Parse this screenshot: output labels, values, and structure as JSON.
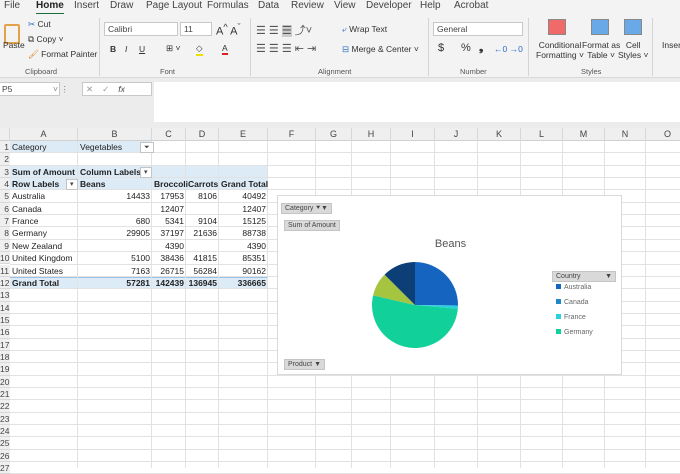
{
  "tabs": [
    "File",
    "Home",
    "Insert",
    "Draw",
    "Page Layout",
    "Formulas",
    "Data",
    "Review",
    "View",
    "Developer",
    "Help",
    "Acrobat"
  ],
  "ribbon": {
    "paste": "Paste",
    "cut": "Cut",
    "copy": "Copy",
    "format_painter": "Format Painter",
    "clipboard": "Clipboard",
    "font_name": "Calibri",
    "font_size": "11",
    "bold": "B",
    "italic": "I",
    "underline": "U",
    "font": "Font",
    "wrap_text": "Wrap Text",
    "merge_center": "Merge & Center",
    "alignment": "Alignment",
    "number_format": "General",
    "currency": "$",
    "percent": "%",
    "comma": "❟",
    "number": "Number",
    "conditional_formatting": [
      "Conditional",
      "Formatting ˅"
    ],
    "format_as_table": [
      "Format as",
      "Table ˅"
    ],
    "cell_styles": [
      "Cell",
      "Styles ˅"
    ],
    "styles": "Styles",
    "insert": "Insert"
  },
  "formula_bar": {
    "name_box": "P5",
    "cancel": "✕",
    "enter": "✓",
    "fx": "fx",
    "value": ""
  },
  "columns": [
    "A",
    "B",
    "C",
    "D",
    "E",
    "F",
    "G",
    "H",
    "I",
    "J",
    "K",
    "L",
    "M",
    "N",
    "O"
  ],
  "rows": [
    "1",
    "2",
    "3",
    "4",
    "5",
    "6",
    "7",
    "8",
    "9",
    "10",
    "11",
    "12",
    "13",
    "14",
    "15",
    "16",
    "17",
    "18",
    "19",
    "20",
    "21",
    "22",
    "23",
    "24",
    "25",
    "26",
    "27"
  ],
  "pivot": {
    "filter_label": "Category",
    "filter_value": "Vegetables",
    "sum_label": "Sum of Amount",
    "column_labels": "Column Labels",
    "row_labels": "Row Labels",
    "headers": [
      "Beans",
      "Broccoli",
      "Carrots",
      "Grand Total"
    ],
    "data": [
      [
        "Australia",
        "14433",
        "17953",
        "8106",
        "40492"
      ],
      [
        "Canada",
        "",
        "12407",
        "",
        "12407"
      ],
      [
        "France",
        "680",
        "5341",
        "9104",
        "15125"
      ],
      [
        "Germany",
        "29905",
        "37197",
        "21636",
        "88738"
      ],
      [
        "New Zealand",
        "",
        "4390",
        "",
        "4390"
      ],
      [
        "United Kingdom",
        "5100",
        "38436",
        "41815",
        "85351"
      ],
      [
        "United States",
        "7163",
        "26715",
        "56284",
        "90162"
      ]
    ],
    "grand_total": [
      "Grand Total",
      "57281",
      "142439",
      "136945",
      "336665"
    ]
  },
  "chart_data": {
    "type": "pie",
    "title": "Beans",
    "categories": [
      "Australia",
      "Canada",
      "France",
      "Germany",
      "United Kingdom",
      "United States"
    ],
    "values": [
      14433,
      0,
      680,
      29905,
      5100,
      7163
    ],
    "colors": [
      "#1565c0",
      "#1e88c8",
      "#2ccfe0",
      "#12d09a",
      "#a5c440",
      "#0d3f77"
    ],
    "legend_title": "Country",
    "legend_visible": [
      "Australia",
      "Canada",
      "France",
      "Germany"
    ],
    "legend": "right",
    "field_buttons": {
      "filter": "Category",
      "values": "Sum of Amount",
      "axis": "Product"
    }
  }
}
